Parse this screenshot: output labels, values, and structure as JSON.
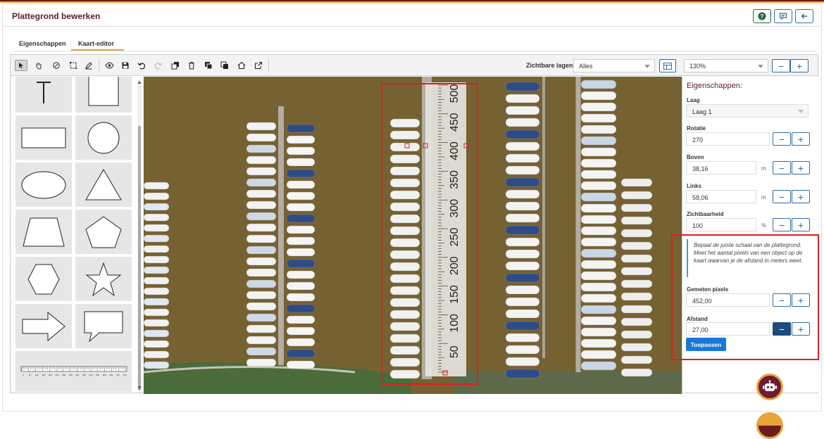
{
  "header": {
    "title": "Plattegrond bewerken",
    "help_icon": "question-icon",
    "comment_icon": "comment-icon",
    "back_icon": "arrow-left-icon"
  },
  "tabs": [
    {
      "label": "Eigenschappen",
      "active": false
    },
    {
      "label": "Kaart-editor",
      "active": true
    }
  ],
  "toolbar": {
    "tools": [
      "select-arrow-icon",
      "pan-hand-icon",
      "rotate-edit-icon",
      "transform-icon",
      "pen-icon",
      "eye-icon",
      "save-icon",
      "undo-icon",
      "redo-icon",
      "copy-icon",
      "delete-icon",
      "bring-front-icon",
      "send-back-icon",
      "home-icon",
      "external-link-icon"
    ],
    "visible_layers_label": "Zichtbare lagen",
    "visible_layers_value": "Alles",
    "zoom_value": "130%"
  },
  "palette": {
    "shapes": [
      "text-T",
      "square",
      "rectangle",
      "circle",
      "ellipse",
      "triangle",
      "trapezoid",
      "pentagon",
      "hexagon",
      "star",
      "arrow",
      "speech-bubble",
      "scale-ruler"
    ],
    "ruler_ticks": [
      "0",
      "50",
      "100",
      "150",
      "200",
      "250",
      "300",
      "350",
      "400",
      "450",
      "500",
      "550",
      "600",
      "650",
      "700",
      "750"
    ]
  },
  "map": {
    "ruler_labels": [
      "500",
      "450",
      "400",
      "350",
      "300",
      "250",
      "200",
      "150",
      "100",
      "50"
    ]
  },
  "properties": {
    "title": "Eigenschappen:",
    "layer": {
      "label": "Laag",
      "value": "Laag 1"
    },
    "rotation": {
      "label": "Rotatie",
      "value": "270"
    },
    "top": {
      "label": "Boven",
      "value": "38,16",
      "unit": "m"
    },
    "left": {
      "label": "Links",
      "value": "58,06",
      "unit": "m"
    },
    "visibility": {
      "label": "Zichtbaarheid",
      "value": "100",
      "unit": "%"
    },
    "hint": "Bepaal de juiste schaal van de plattegrond. Meet het aantal pixels van een object op de kaart waarvan je de afstand in meters weet.",
    "measured_pixels": {
      "label": "Gemeten pixels",
      "value": "452,00"
    },
    "distance": {
      "label": "Afstand",
      "value": "27,00"
    },
    "apply_label": "Toepassen"
  },
  "colors": {
    "accent": "#5a1f28",
    "brand_orange": "#e8a33a",
    "primary": "#1978d4",
    "highlight": "#e01c24"
  }
}
